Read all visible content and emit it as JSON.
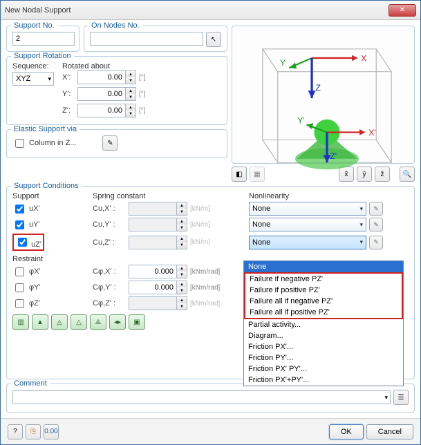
{
  "title": "New Nodal Support",
  "support_no": {
    "label": "Support No.",
    "value": "2"
  },
  "on_nodes": {
    "label": "On Nodes No.",
    "value": ""
  },
  "rotation": {
    "title": "Support Rotation",
    "sequence_label": "Sequence:",
    "sequence_value": "XYZ",
    "rotated_label": "Rotated about",
    "axes": [
      {
        "label": "X':",
        "value": "0.00",
        "unit": "[°]"
      },
      {
        "label": "Y':",
        "value": "0.00",
        "unit": "[°]"
      },
      {
        "label": "Z':",
        "value": "0.00",
        "unit": "[°]"
      }
    ]
  },
  "elastic": {
    "title": "Elastic Support via",
    "column_label": "Column in Z...",
    "column_checked": false
  },
  "conditions": {
    "title": "Support Conditions",
    "support_hdr": "Support",
    "spring_hdr": "Spring constant",
    "nonlin_hdr": "Nonlinearity",
    "restraint_hdr": "Restraint",
    "rows_support": [
      {
        "cb": true,
        "lbl": "uX'",
        "spring": "Cu,X'  :",
        "val": "",
        "unit": "[kN/m]",
        "nonlin": "None"
      },
      {
        "cb": true,
        "lbl": "uY'",
        "spring": "Cu,Y'  :",
        "val": "",
        "unit": "[kN/m]",
        "nonlin": "None"
      },
      {
        "cb": true,
        "lbl": "uZ'",
        "spring": "Cu,Z'  :",
        "val": "",
        "unit": "[kN/m]",
        "nonlin": "None",
        "highlight": true
      }
    ],
    "rows_restraint": [
      {
        "cb": false,
        "lbl": "φX'",
        "spring": "Cφ,X'  :",
        "val": "0.000",
        "unit": "[kNm/rad]"
      },
      {
        "cb": false,
        "lbl": "φY'",
        "spring": "Cφ,Y'  :",
        "val": "0.000",
        "unit": "[kNm/rad]"
      },
      {
        "cb": false,
        "lbl": "φZ'",
        "spring": "Cφ,Z'  :",
        "val": "",
        "unit": "[kNm/rad]"
      }
    ]
  },
  "dropdown": {
    "items": [
      "None",
      "Failure if negative PZ'",
      "Failure if positive PZ'",
      "Failure all if negative PZ'",
      "Failure all if positive PZ'",
      "Partial activity...",
      "Diagram...",
      "Friction PX'...",
      "Friction PY'...",
      "Friction PX' PY'...",
      "Friction PX'+PY'..."
    ],
    "selected": 0,
    "redbox_start": 1,
    "redbox_end": 4
  },
  "comment": {
    "title": "Comment",
    "value": ""
  },
  "buttons": {
    "ok": "OK",
    "cancel": "Cancel"
  },
  "axis_labels": {
    "x": "X",
    "y": "Y",
    "z": "Z",
    "xp": "X'",
    "yp": "Y'",
    "zp": "Z'"
  }
}
